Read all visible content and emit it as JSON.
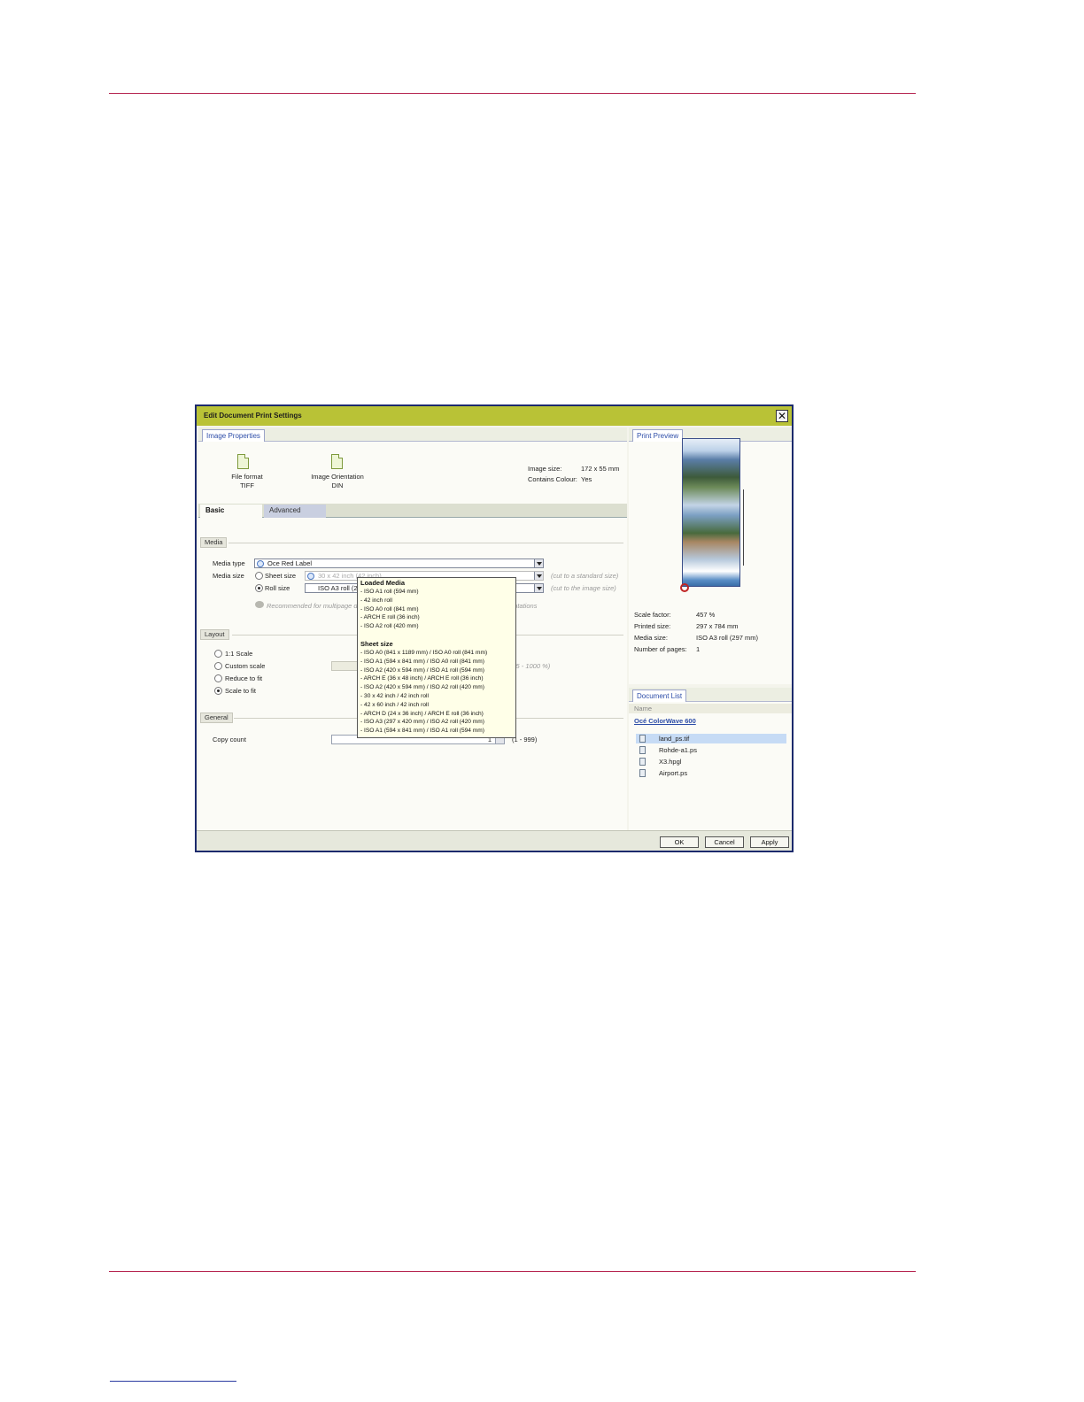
{
  "dialog": {
    "title": "Edit Document Print Settings",
    "close_symbol": "✕",
    "image_properties": {
      "tab": "Image Properties",
      "file_format_label": "File format",
      "file_format_value": "TIFF",
      "orientation_label": "Image Orientation",
      "orientation_value": "DIN",
      "image_size_label": "Image size:",
      "image_size_value": "172 x 55 mm",
      "contains_colour_label": "Contains Colour:",
      "contains_colour_value": "Yes"
    },
    "subtabs": {
      "basic": "Basic",
      "advanced": "Advanced"
    },
    "media": {
      "section": "Media",
      "media_type_label": "Media type",
      "media_type_value": "Oce Red Label",
      "media_size_label": "Media size",
      "sheet_size_label": "Sheet size",
      "sheet_size_value": "30 x 42 inch (42 inch)",
      "sheet_size_note": "(cut to a standard size)",
      "roll_size_label": "Roll size",
      "roll_size_value": "ISO A3 roll (2",
      "roll_size_note": "(cut to the image size)",
      "recommended_left": "Recommended for multipage d",
      "recommended_right": "entations"
    },
    "layout": {
      "section": "Layout",
      "options": [
        "1:1 Scale",
        "Custom scale",
        "Reduce to fit",
        "Scale to fit"
      ],
      "custom_range": "(5 - 1000 %)"
    },
    "general": {
      "section": "General",
      "copy_count_label": "Copy count",
      "copy_count_value": "1",
      "copy_range": "(1 - 999)"
    },
    "popup": {
      "loaded_media_header": "Loaded Media",
      "loaded_media": [
        "- ISO A1 roll (594 mm)",
        "- 42 inch roll",
        "- ISO A0 roll (841 mm)",
        "- ARCH E roll (36 inch)",
        "- ISO A2 roll (420 mm)"
      ],
      "sheet_size_header": "Sheet size",
      "sheet_sizes": [
        "- ISO A0 (841 x 1189 mm) / ISO A0 roll (841 mm)",
        "- ISO A1 (594 x 841 mm) / ISO A0 roll (841 mm)",
        "- ISO A2 (420 x 594 mm) / ISO A1 roll (594 mm)",
        "- ARCH E (36 x 48 inch) / ARCH E roll (36 inch)",
        "- ISO A2 (420 x 594 mm) / ISO A2 roll (420 mm)",
        "- 30 x 42 inch / 42 inch roll",
        "- 42 x 60 inch / 42 inch roll",
        "- ARCH D (24 x 36 inch) / ARCH E roll (36 inch)",
        "- ISO A3 (297 x 420 mm) / ISO A2 roll (420 mm)",
        "- ISO A1 (594 x 841 mm) / ISO A1 roll (594 mm)"
      ]
    },
    "print_preview": {
      "tab": "Print Preview",
      "scale_factor_label": "Scale factor:",
      "scale_factor_value": "457 %",
      "printed_size_label": "Printed size:",
      "printed_size_value": "297 x 784 mm",
      "media_size_label": "Media size:",
      "media_size_value": "ISO A3 roll (297 mm)",
      "pages_label": "Number of pages:",
      "pages_value": "1"
    },
    "document_list": {
      "tab": "Document List",
      "column": "Name",
      "printer": "Océ ColorWave 600",
      "documents": [
        "land_ps.tif",
        "Rohde-a1.ps",
        "X3.hpgl",
        "Airport.ps"
      ]
    },
    "buttons": {
      "ok": "OK",
      "cancel": "Cancel",
      "apply": "Apply"
    }
  },
  "colors": {
    "titlebar": "#b9c236",
    "rule": "#b5234f",
    "accent": "#2d4da8"
  }
}
